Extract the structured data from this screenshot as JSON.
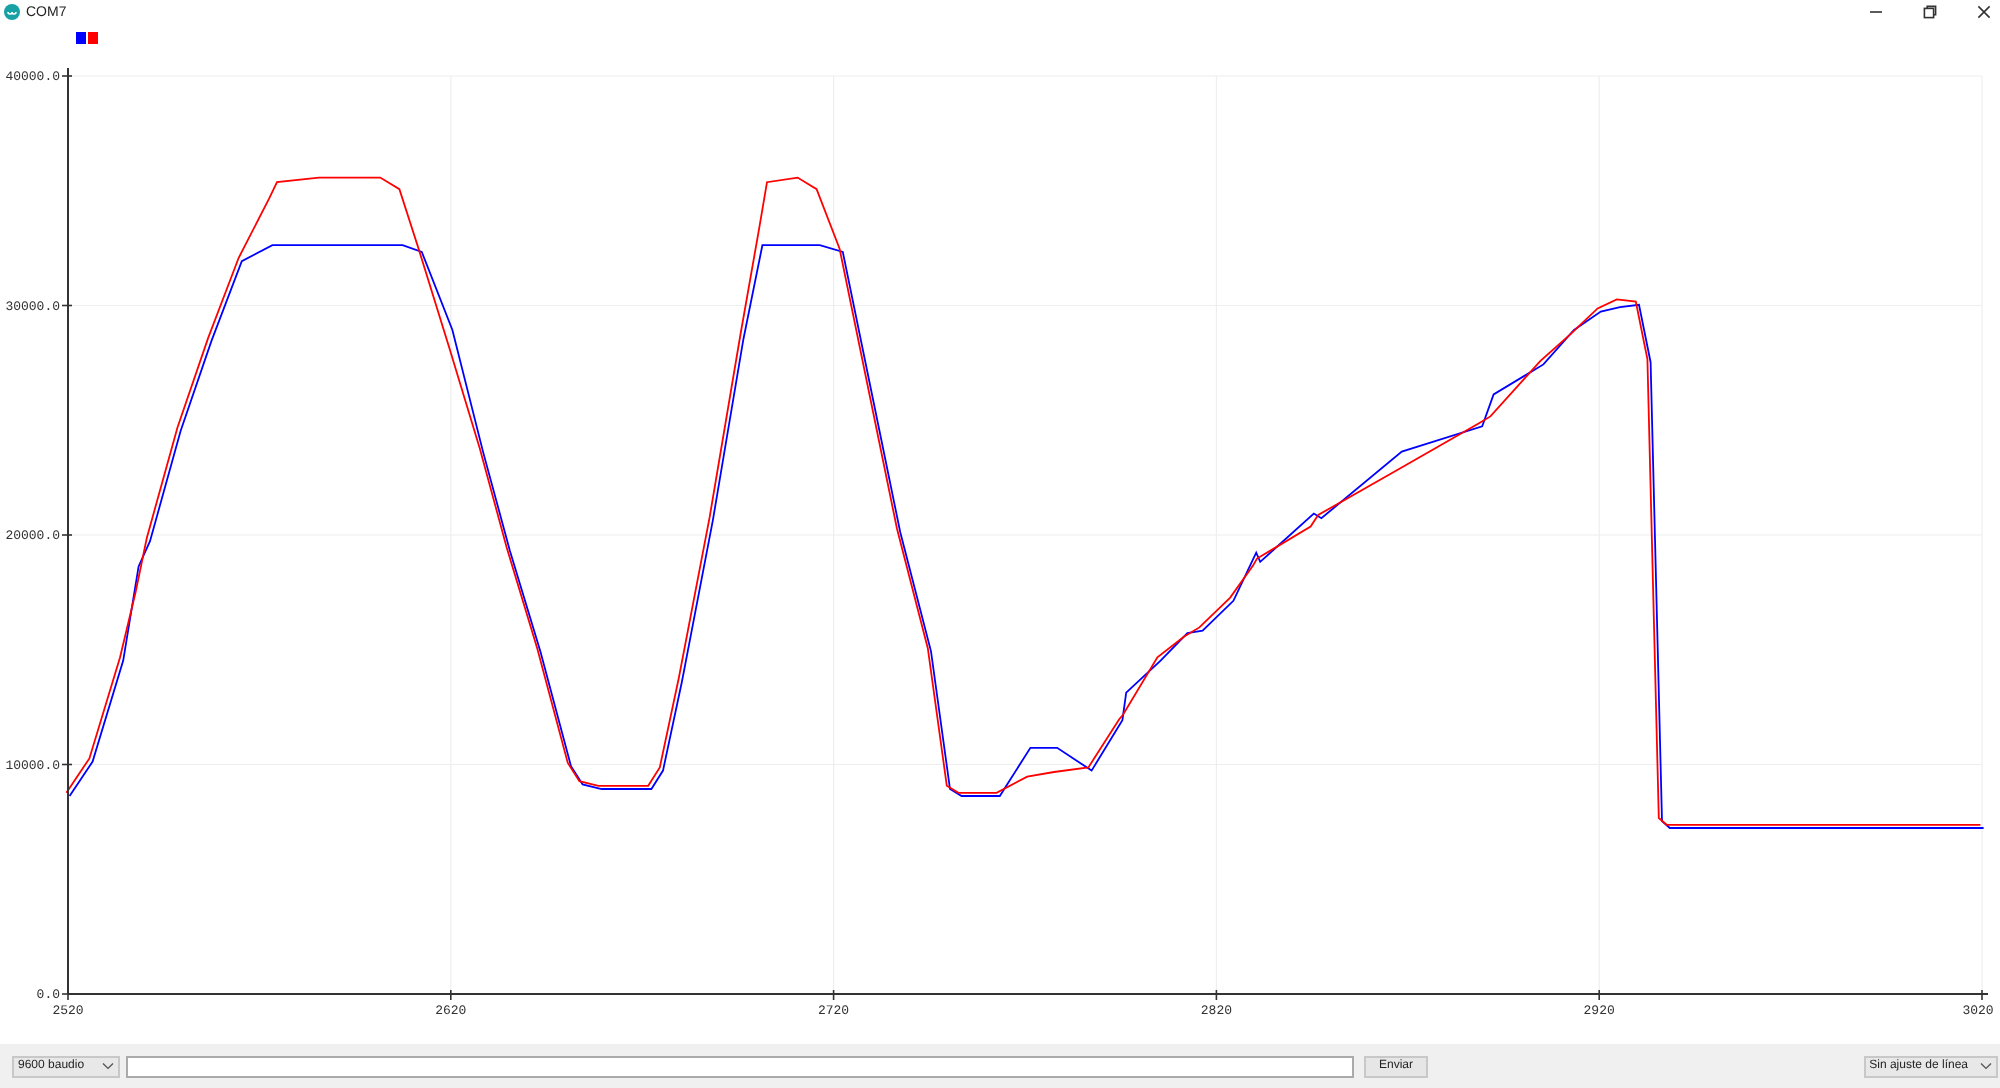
{
  "window": {
    "title": "COM7"
  },
  "plot": {
    "chart_data": {
      "type": "line",
      "grid": true,
      "xlim": [
        2520,
        3020
      ],
      "ylim": [
        0,
        40000
      ],
      "xticks": [
        2520,
        2620,
        2720,
        2820,
        2920,
        3020
      ],
      "yticks": [
        {
          "value": 0,
          "label": "0.0"
        },
        {
          "value": 10000,
          "label": "10000.0"
        },
        {
          "value": 20000,
          "label": "20000.0"
        },
        {
          "value": 30000,
          "label": "30000.0"
        },
        {
          "value": 40000,
          "label": "40000.0"
        }
      ],
      "x": [
        2520,
        2526,
        2534,
        2538,
        2541,
        2549,
        2557,
        2565,
        2573,
        2575,
        2586,
        2602,
        2607,
        2612,
        2620,
        2628,
        2635,
        2643,
        2651,
        2654,
        2659,
        2672,
        2675,
        2680,
        2688,
        2696,
        2701,
        2703,
        2711,
        2716,
        2722,
        2730,
        2737,
        2745,
        2750,
        2753,
        2763,
        2771,
        2778,
        2787,
        2795,
        2796,
        2805,
        2812,
        2816,
        2824,
        2830,
        2831,
        2845,
        2847,
        2868,
        2889,
        2892,
        2905,
        2913,
        2920,
        2925,
        2930,
        2933,
        2936,
        2938,
        3020
      ],
      "series": [
        {
          "color": "#0000ff",
          "values": [
            8700,
            10200,
            14600,
            18700,
            19800,
            24600,
            28500,
            32000,
            32700,
            32700,
            32700,
            32700,
            32700,
            32400,
            29000,
            23700,
            19400,
            15000,
            10000,
            9200,
            9000,
            9000,
            9800,
            13700,
            20700,
            28600,
            32700,
            32700,
            32700,
            32700,
            32400,
            25900,
            20200,
            15000,
            9000,
            8700,
            8700,
            10800,
            10800,
            9800,
            12000,
            13200,
            14600,
            15800,
            15900,
            17200,
            19300,
            18900,
            21000,
            20800,
            23700,
            24800,
            26200,
            27500,
            29000,
            29800,
            30000,
            30100,
            27600,
            7600,
            7300,
            7300
          ]
        },
        {
          "color": "#ff0000",
          "values": [
            8700,
            10200,
            14600,
            17400,
            19800,
            24600,
            28500,
            32000,
            34600,
            35300,
            35500,
            35500,
            35000,
            32400,
            28100,
            23700,
            19400,
            15000,
            10000,
            9200,
            9000,
            9000,
            9800,
            13700,
            20700,
            28600,
            33300,
            35300,
            35500,
            35000,
            32400,
            25900,
            20200,
            15000,
            9000,
            8700,
            8700,
            9400,
            9600,
            9800,
            11900,
            12100,
            14600,
            15500,
            15900,
            17200,
            18600,
            18900,
            20300,
            20800,
            22800,
            24800,
            25100,
            27500,
            28700,
            29800,
            30200,
            30100,
            27600,
            7600,
            7300,
            7300
          ]
        }
      ]
    }
  },
  "bottom_bar": {
    "baud_select": "9600 baudio",
    "send_button": "Enviar",
    "line_ending_select": "Sin ajuste de línea"
  }
}
